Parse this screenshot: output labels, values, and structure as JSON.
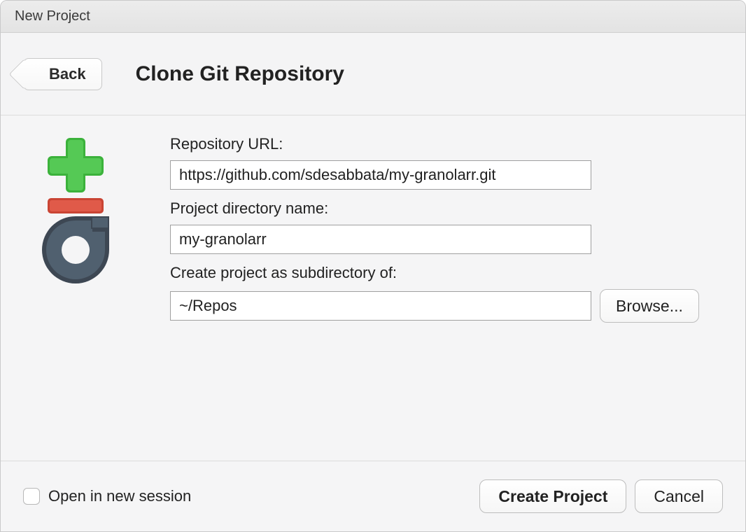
{
  "window": {
    "title": "New Project"
  },
  "header": {
    "back_label": "Back",
    "page_title": "Clone Git Repository"
  },
  "form": {
    "repo_url_label": "Repository URL:",
    "repo_url_value": "https://github.com/sdesabbata/my-granolarr.git",
    "dir_name_label": "Project directory name:",
    "dir_name_value": "my-granolarr",
    "subdir_label": "Create project as subdirectory of:",
    "subdir_value": "~/Repos",
    "browse_label": "Browse..."
  },
  "footer": {
    "open_new_session_label": "Open in new session",
    "open_new_session_checked": false,
    "create_label": "Create Project",
    "cancel_label": "Cancel"
  },
  "icons": {
    "git_create": "git-create-icon"
  }
}
